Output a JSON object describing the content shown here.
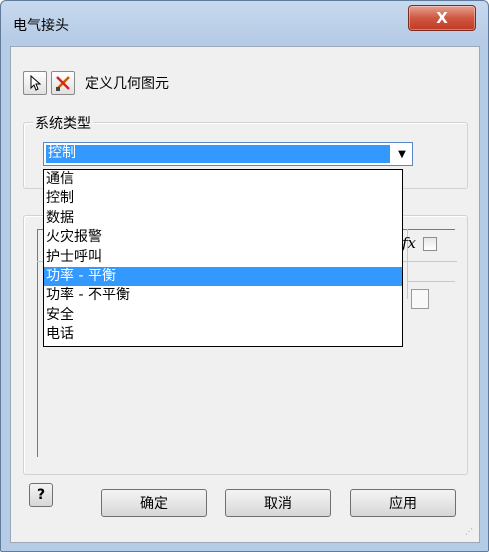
{
  "window": {
    "title": "电气接头",
    "close_glyph": "X"
  },
  "toolbar": {
    "label": "定义几何图元"
  },
  "system_type": {
    "group_title": "系统类型",
    "selected": "控制",
    "options": [
      "通信",
      "控制",
      "数据",
      "火灾报警",
      "护士呼叫",
      "功率 - 平衡",
      "功率 - 不平衡",
      "安全",
      "电话"
    ],
    "highlighted_index": 5
  },
  "params": {
    "fx_label": "fx"
  },
  "buttons": {
    "help": "?",
    "ok": "确定",
    "cancel": "取消",
    "apply": "应用"
  },
  "colors": {
    "selection": "#3399ff",
    "close_button": "#c94a35"
  }
}
